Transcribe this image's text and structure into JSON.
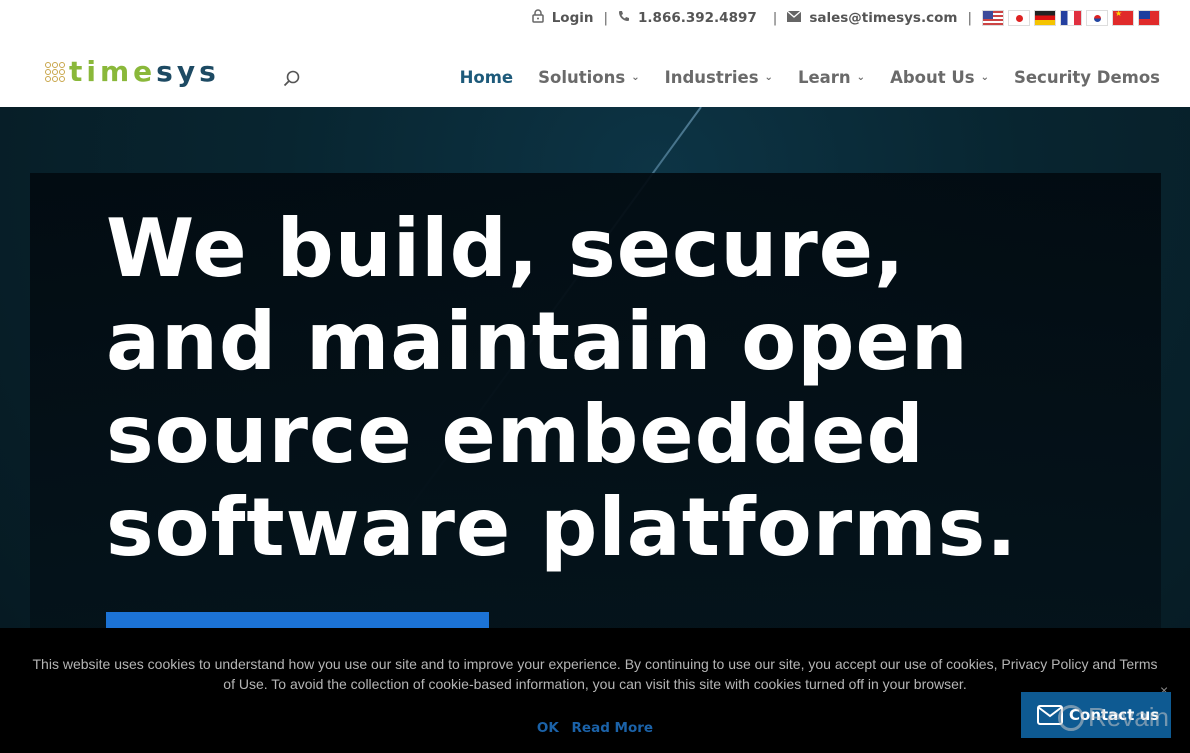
{
  "topbar": {
    "login_label": "Login",
    "phone": "1.866.392.4897",
    "email": "sales@timesys.com",
    "separator": "|",
    "icons": {
      "login": "lock-icon",
      "phone": "phone-icon",
      "email": "envelope-icon"
    },
    "flags": [
      {
        "name": "flag-us",
        "language": "English"
      },
      {
        "name": "flag-japan",
        "language": "Japanese"
      },
      {
        "name": "flag-germany",
        "language": "German"
      },
      {
        "name": "flag-france",
        "language": "French"
      },
      {
        "name": "flag-korea",
        "language": "Korean"
      },
      {
        "name": "flag-china",
        "language": "Chinese"
      },
      {
        "name": "flag-taiwan",
        "language": "Traditional Chinese"
      }
    ]
  },
  "header": {
    "logo": {
      "part1": "time",
      "part2": "sys"
    },
    "search_icon": "search-icon",
    "nav": [
      {
        "label": "Home",
        "active": true,
        "dropdown": false
      },
      {
        "label": "Solutions",
        "dropdown": true
      },
      {
        "label": "Industries",
        "dropdown": true
      },
      {
        "label": "Learn",
        "dropdown": true
      },
      {
        "label": "About Us",
        "dropdown": true
      },
      {
        "label": "Security Demos",
        "dropdown": false
      }
    ],
    "chevron": "⌄"
  },
  "hero": {
    "title": "We build, secure, and maintain open source embedded software platforms."
  },
  "cookie_banner": {
    "text": "This website uses cookies to understand how you use our site and to improve your experience. By continuing to use our site, you accept our use of cookies, Privacy Policy and Terms of Use. To avoid the collection of cookie-based information, you can visit this site with cookies turned off in your browser.",
    "ok_label": "OK",
    "read_more_label": "Read More"
  },
  "contact_widget": {
    "label": "Contact us",
    "close": "×"
  },
  "watermark": {
    "text": "Revain"
  },
  "colors": {
    "brand_green": "#8ab83a",
    "brand_navy": "#1d4a63",
    "nav_active": "#1d5a7a",
    "accent_blue": "#1c73d6",
    "contact_blue": "#0e5a92",
    "cookie_link": "#1b62a8"
  }
}
